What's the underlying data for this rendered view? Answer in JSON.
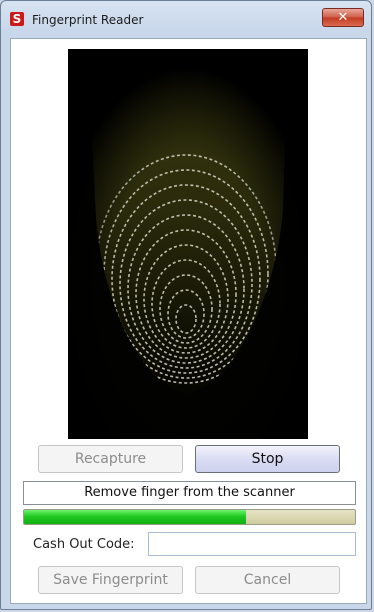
{
  "window": {
    "title": "Fingerprint Reader",
    "app_icon_letter": "S",
    "close_glyph": "✕"
  },
  "scanner": {
    "image_description_icon": "fingerprint-image"
  },
  "buttons": {
    "recapture": "Recapture",
    "stop": "Stop",
    "save_fingerprint": "Save Fingerprint",
    "cancel": "Cancel"
  },
  "status": {
    "message": "Remove finger from the scanner",
    "progress_fraction": 0.67
  },
  "cash_out": {
    "label": "Cash Out Code:",
    "value": "",
    "placeholder": ""
  },
  "colors": {
    "progress_fill": "#22c822",
    "progress_track": "#d9d6b0",
    "close_button": "#c9402a",
    "app_icon": "#cc1a1a"
  }
}
